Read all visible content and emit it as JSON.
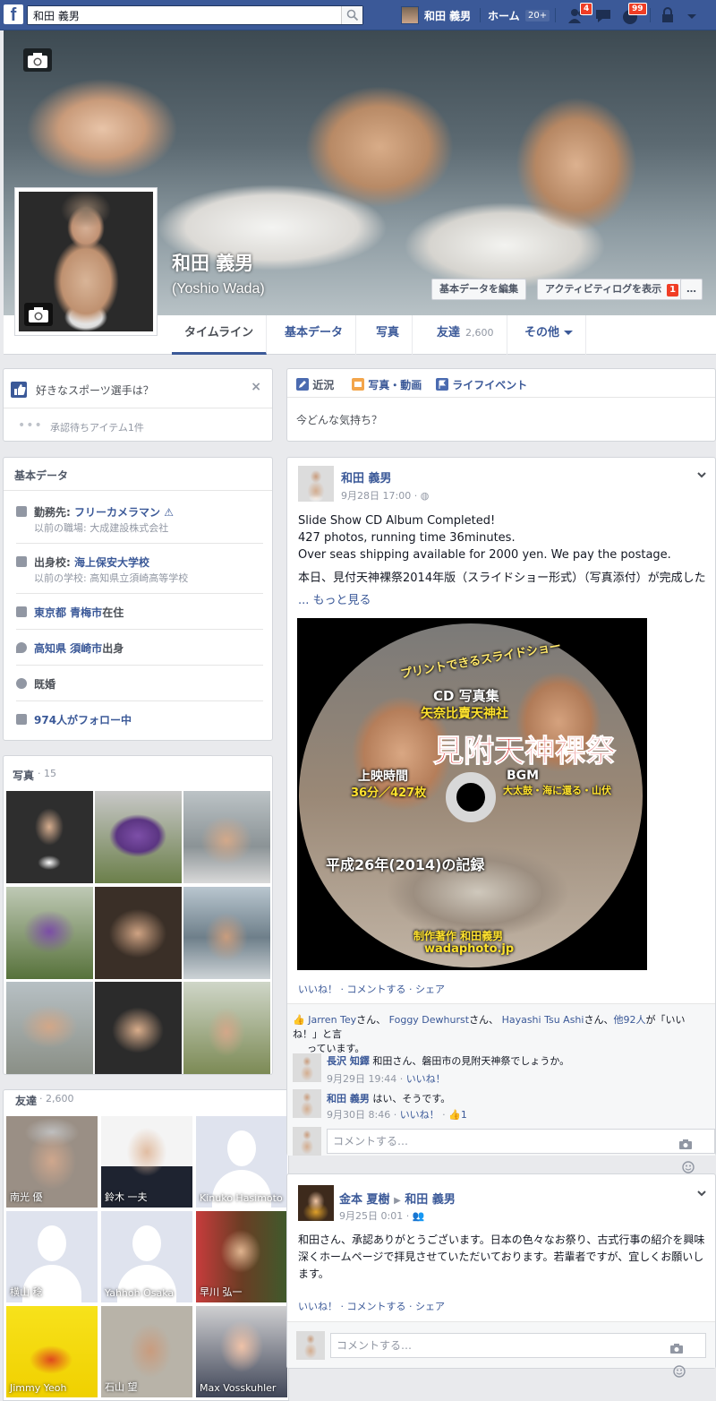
{
  "topbar": {
    "search_value": "和田 義男",
    "user_name": "和田 義男",
    "home_label": "ホーム",
    "home_count": "20+",
    "friend_requests_badge": "4",
    "notifications_badge": "99"
  },
  "profile": {
    "name_jp": "和田 義男",
    "name_en": "(Yoshio Wada)",
    "edit_about_button": "基本データを編集",
    "activity_log_button": "アクティビティログを表示",
    "activity_log_count": "1",
    "more_button": "…"
  },
  "tabs": [
    {
      "label": "タイムライン"
    },
    {
      "label": "基本データ"
    },
    {
      "label": "写真"
    },
    {
      "label": "友達",
      "count": "2,600"
    },
    {
      "label": "その他"
    }
  ],
  "prompt_card": {
    "question": "好きなスポーツ選手は？",
    "pending": "承認待ちアイテム1件"
  },
  "about": {
    "title": "基本データ",
    "work_label": "勤務先: ",
    "work_value": "フリーカメラマン",
    "work_prev": "以前の職場: 大成建設株式会社",
    "school_label": "出身校: ",
    "school_value": "海上保安大学校",
    "school_prev": "以前の学校: 高知県立須崎高等学校",
    "lives": "東京都 青梅市",
    "lives_suffix": "在住",
    "from": "高知県 須崎市",
    "from_suffix": "出身",
    "relationship": "既婚",
    "followers": "974人がフォロー中"
  },
  "photos": {
    "title": "写真",
    "count": "15"
  },
  "friends": {
    "title": "友達",
    "count": "2,600",
    "names": [
      "南光 優",
      "鈴木 一夫",
      "Kinuko Hasimoto",
      "横山 稔",
      "Yahhoh Osaka",
      "早川 弘一",
      "Jimmy Yeoh",
      "石山 望",
      "Max Vosskuhler"
    ]
  },
  "composer": {
    "status_tab": "近況",
    "photo_tab": "写真・動画",
    "life_event_tab": "ライフイベント",
    "placeholder": "今どんな気持ち？"
  },
  "post1": {
    "author": "和田 義男",
    "time": "9月28日 17:00 · ",
    "line1": "Slide Show CD Album Completed!",
    "line2": "427 photos, running time 36minutes.",
    "line3": "Over seas shipping available for 2000 yen. We pay the postage.",
    "line4": "本日、見付天神裸祭2014年版（スライドショー形式）（写真添付）が完成した",
    "see_more": "... もっと見る",
    "cd": {
      "top_arc": "プリントできるスライドショー",
      "label1": "CD 写真集",
      "label2": "矢奈比賣天神社",
      "title": "見附天神裸祭",
      "runtime_label": "上映時間",
      "runtime": "36分／427枚",
      "bgm_label": "BGM",
      "bgm": "大太鼓・海に還る・山伏",
      "record": "平成26年(2014)の記録",
      "author": "制作著作 和田義男",
      "site": "wadaphoto.jp"
    },
    "actions": "いいね！ · コメントする · シェア",
    "likes_name1": "Jarren Tey",
    "likes_name2": "Foggy Dewhurst",
    "likes_name3": "Hayashi Tsu Ashi",
    "likes_others": "他92人",
    "likes_tail1": "さん、",
    "likes_tail2": "が「いいね！」と言",
    "likes_tail3": "っています。",
    "comments": [
      {
        "author": "長沢 知鐸",
        "text": "和田さん、磐田市の見附天神祭でしょうか。",
        "time": "9月29日 19:44 · ",
        "like": "いいね！"
      },
      {
        "author": "和田 義男",
        "text": "はい、そうです。",
        "time": "9月30日 8:46 · ",
        "like": "いいね！",
        "like_count": "1"
      }
    ],
    "comment_placeholder": "コメントする…"
  },
  "post2": {
    "author": "金本 夏樹",
    "target": "和田 義男",
    "time": "9月25日 0:01 · ",
    "line1": "和田さん、承認ありがとうございます。日本の色々なお祭り、古式行事の紹介を興味",
    "line2": "深くホームページで拝見させていただいております。若輩者ですが、宜しくお願いし",
    "line3": "ます。",
    "actions": "いいね！ · コメントする · シェア",
    "comment_placeholder": "コメントする…"
  }
}
